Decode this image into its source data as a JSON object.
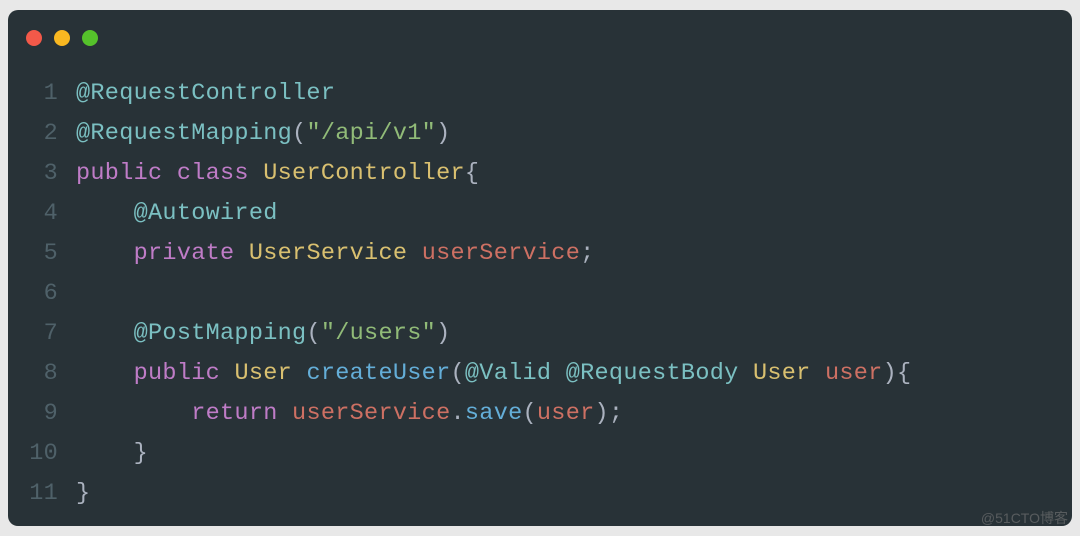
{
  "watermark": "@51CTO博客",
  "traffic_lights": {
    "red": "#f35949",
    "yellow": "#f9b821",
    "green": "#55c22b"
  },
  "colors": {
    "bg": "#283237",
    "gutter": "#4f6169",
    "default": "#abb2bf",
    "anno": "#7bc0c2",
    "keyword": "#bf7cc7",
    "type": "#d9c070",
    "string": "#91bb78",
    "ident": "#cd7063",
    "call": "#64aed8"
  },
  "code": [
    {
      "n": 1,
      "tokens": [
        {
          "c": "anno",
          "t": "@RequestController"
        }
      ]
    },
    {
      "n": 2,
      "tokens": [
        {
          "c": "anno",
          "t": "@RequestMapping"
        },
        {
          "c": "punct",
          "t": "("
        },
        {
          "c": "str",
          "t": "\"/api/v1\""
        },
        {
          "c": "punct",
          "t": ")"
        }
      ]
    },
    {
      "n": 3,
      "tokens": [
        {
          "c": "kw",
          "t": "public"
        },
        {
          "c": "default",
          "t": " "
        },
        {
          "c": "kw",
          "t": "class"
        },
        {
          "c": "default",
          "t": " "
        },
        {
          "c": "type",
          "t": "UserController"
        },
        {
          "c": "brace",
          "t": "{"
        }
      ]
    },
    {
      "n": 4,
      "tokens": [
        {
          "c": "default",
          "t": "    "
        },
        {
          "c": "anno",
          "t": "@Autowired"
        }
      ]
    },
    {
      "n": 5,
      "tokens": [
        {
          "c": "default",
          "t": "    "
        },
        {
          "c": "kw",
          "t": "private"
        },
        {
          "c": "default",
          "t": " "
        },
        {
          "c": "type",
          "t": "UserService"
        },
        {
          "c": "default",
          "t": " "
        },
        {
          "c": "ident",
          "t": "userService"
        },
        {
          "c": "punct",
          "t": ";"
        }
      ]
    },
    {
      "n": 6,
      "tokens": [
        {
          "c": "default",
          "t": ""
        }
      ]
    },
    {
      "n": 7,
      "tokens": [
        {
          "c": "default",
          "t": "    "
        },
        {
          "c": "anno",
          "t": "@PostMapping"
        },
        {
          "c": "punct",
          "t": "("
        },
        {
          "c": "str",
          "t": "\"/users\""
        },
        {
          "c": "punct",
          "t": ")"
        }
      ]
    },
    {
      "n": 8,
      "tokens": [
        {
          "c": "default",
          "t": "    "
        },
        {
          "c": "kw",
          "t": "public"
        },
        {
          "c": "default",
          "t": " "
        },
        {
          "c": "type",
          "t": "User"
        },
        {
          "c": "default",
          "t": " "
        },
        {
          "c": "call",
          "t": "createUser"
        },
        {
          "c": "punct",
          "t": "("
        },
        {
          "c": "anno",
          "t": "@Valid"
        },
        {
          "c": "default",
          "t": " "
        },
        {
          "c": "anno",
          "t": "@RequestBody"
        },
        {
          "c": "default",
          "t": " "
        },
        {
          "c": "type",
          "t": "User"
        },
        {
          "c": "default",
          "t": " "
        },
        {
          "c": "ident",
          "t": "user"
        },
        {
          "c": "punct",
          "t": ")"
        },
        {
          "c": "brace",
          "t": "{"
        }
      ]
    },
    {
      "n": 9,
      "tokens": [
        {
          "c": "default",
          "t": "        "
        },
        {
          "c": "kw",
          "t": "return"
        },
        {
          "c": "default",
          "t": " "
        },
        {
          "c": "ident",
          "t": "userService"
        },
        {
          "c": "punct",
          "t": "."
        },
        {
          "c": "call",
          "t": "save"
        },
        {
          "c": "punct",
          "t": "("
        },
        {
          "c": "ident",
          "t": "user"
        },
        {
          "c": "punct",
          "t": ");"
        }
      ]
    },
    {
      "n": 10,
      "tokens": [
        {
          "c": "default",
          "t": "    "
        },
        {
          "c": "brace",
          "t": "}"
        }
      ]
    },
    {
      "n": 11,
      "tokens": [
        {
          "c": "brace",
          "t": "}"
        }
      ]
    }
  ]
}
